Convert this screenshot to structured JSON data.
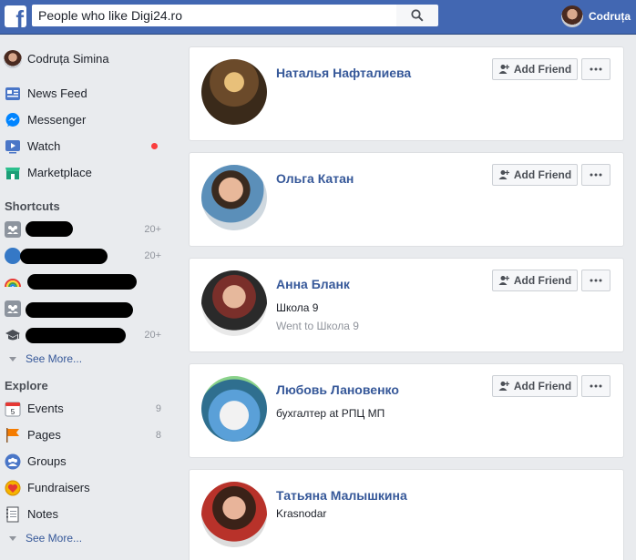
{
  "topbar": {
    "search_value": "People who like Digi24.ro",
    "profile_name": "Codruța"
  },
  "sidebar": {
    "profile_name": "Codruța Simina",
    "main_items": [
      {
        "label": "News Feed",
        "icon": "news-feed-icon"
      },
      {
        "label": "Messenger",
        "icon": "messenger-icon"
      },
      {
        "label": "Watch",
        "icon": "watch-icon"
      },
      {
        "label": "Marketplace",
        "icon": "marketplace-icon"
      }
    ],
    "shortcuts_heading": "Shortcuts",
    "shortcuts": [
      {
        "count": "20+"
      },
      {
        "count": "20+"
      },
      {
        "count": ""
      },
      {
        "count": ""
      },
      {
        "count": "20+"
      }
    ],
    "see_more_1": "See More...",
    "explore_heading": "Explore",
    "explore_items": [
      {
        "label": "Events",
        "count": "9",
        "icon": "events-icon"
      },
      {
        "label": "Pages",
        "count": "8",
        "icon": "pages-flag-icon"
      },
      {
        "label": "Groups",
        "count": "",
        "icon": "groups-icon"
      },
      {
        "label": "Fundraisers",
        "count": "",
        "icon": "fundraisers-icon"
      },
      {
        "label": "Notes",
        "count": "",
        "icon": "notes-icon"
      }
    ],
    "see_more_2": "See More..."
  },
  "results": [
    {
      "name": "Наталья Нафталиева",
      "line1": "",
      "line2": "",
      "button": "Add Friend"
    },
    {
      "name": "Ольга Катан",
      "line1": "",
      "line2": "",
      "button": "Add Friend"
    },
    {
      "name": "Анна Бланк",
      "line1": "Школа 9",
      "line2": "Went to Школа 9",
      "button": "Add Friend"
    },
    {
      "name": "Любовь Лановенко",
      "line1": "бухгалтер at РПЦ МП",
      "line2": "",
      "button": "Add Friend"
    },
    {
      "name": "Татьяна Малышкина",
      "line1": "Krasnodar",
      "line2": "",
      "button": ""
    }
  ],
  "colors": {
    "brand": "#4267b2",
    "link": "#365899",
    "notification": "#fa3e3e"
  }
}
